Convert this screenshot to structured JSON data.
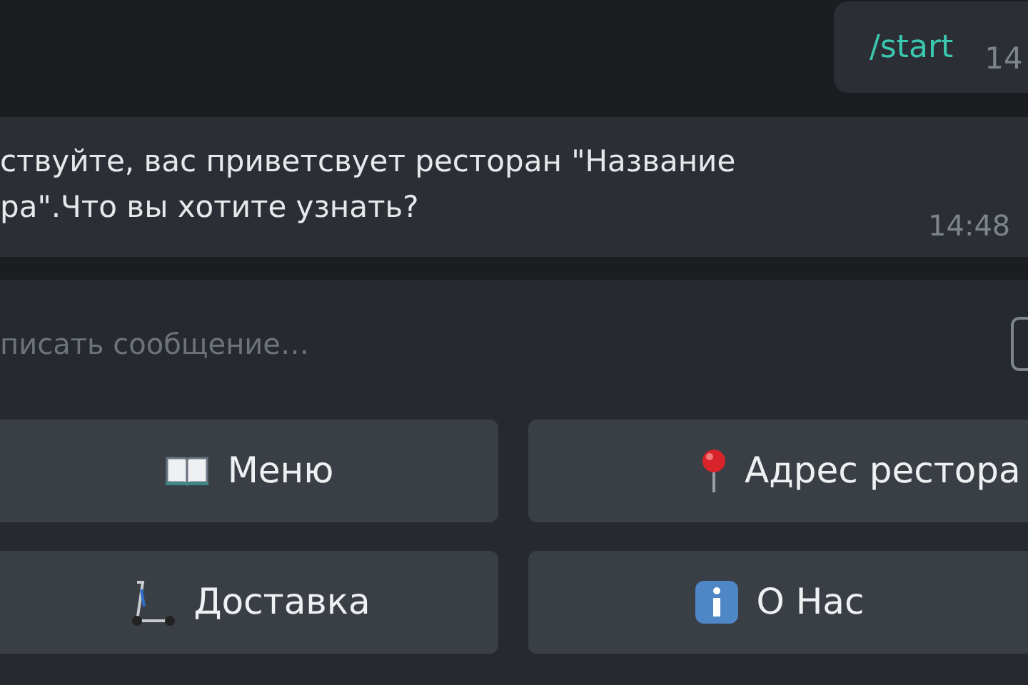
{
  "messages": [
    {
      "kind": "outgoing",
      "text": "/start",
      "time": "14"
    },
    {
      "kind": "incoming",
      "lines": [
        "ствуйте, вас приветсвует ресторан \"Название",
        "ра\".Что вы хотите узнать?"
      ],
      "time": "14:48"
    }
  ],
  "composer": {
    "placeholder": "писать сообщение…"
  },
  "keyboard": [
    {
      "label": "Меню"
    },
    {
      "label": "Адрес рестора"
    },
    {
      "label": "Доставка"
    },
    {
      "label": "О Нас"
    }
  ]
}
